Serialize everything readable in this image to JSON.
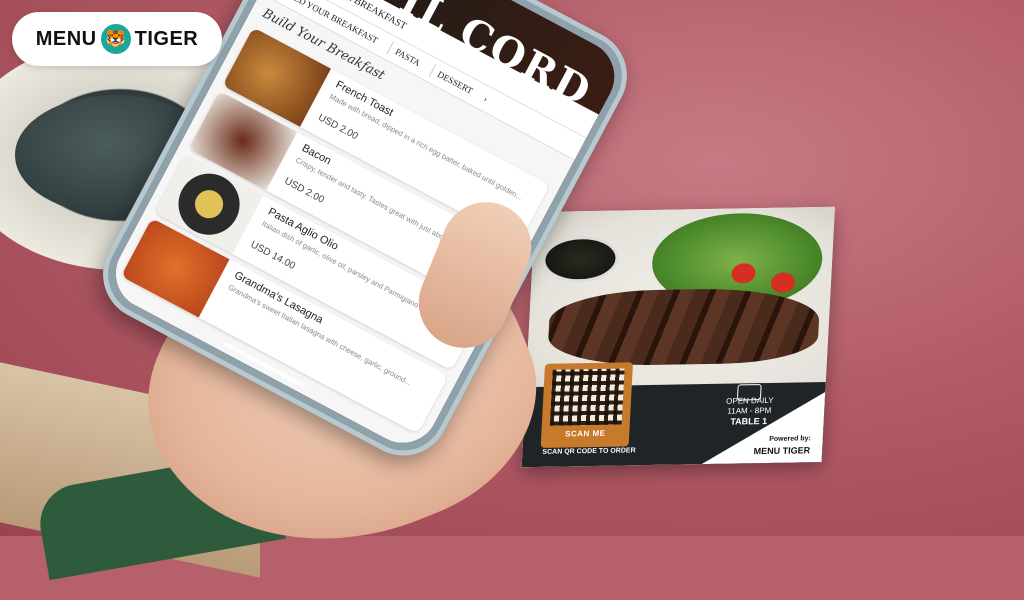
{
  "brand": {
    "left": "MENU",
    "right": "TIGER",
    "icon": "tiger-head-icon",
    "accent": "#1aa79a"
  },
  "phone": {
    "hero_title": "IL CORD",
    "header": {
      "back_icon": "chevron-left-icon",
      "label": "BUILD YOUR BREAKFAST"
    },
    "tabs": [
      "BUILD YOUR BREAKFAST",
      "PASTA",
      "DESSERT"
    ],
    "tabs_next_icon": "chevron-right-icon",
    "section_title": "Build Your Breakfast",
    "items": [
      {
        "name": "French Toast",
        "desc": "Made with bread, dipped in a rich egg batter, baked until golden...",
        "price": "USD 2.00"
      },
      {
        "name": "Bacon",
        "desc": "Crispy, tender and tasty. Tastes great with just about any other...",
        "price": "USD 2.00"
      },
      {
        "name": "Pasta Aglio Olio",
        "desc": "Italian dish of garlic, olive oil, parsley and Parmigiano Reggiano...",
        "price": "USD 14.00"
      },
      {
        "name": "Grandma's Lasagna",
        "desc": "Grandma's sweet Italian lasagna with cheese, garlic, ground...",
        "price": ""
      }
    ]
  },
  "card": {
    "scan_label": "SCAN ME",
    "scan_order": "SCAN QR CODE TO ORDER",
    "open_daily": "OPEN DAILY",
    "hours": "11AM - 8PM",
    "table": "TABLE 1",
    "powered": "Powered by:",
    "powered_brand": "MENU TIGER"
  }
}
